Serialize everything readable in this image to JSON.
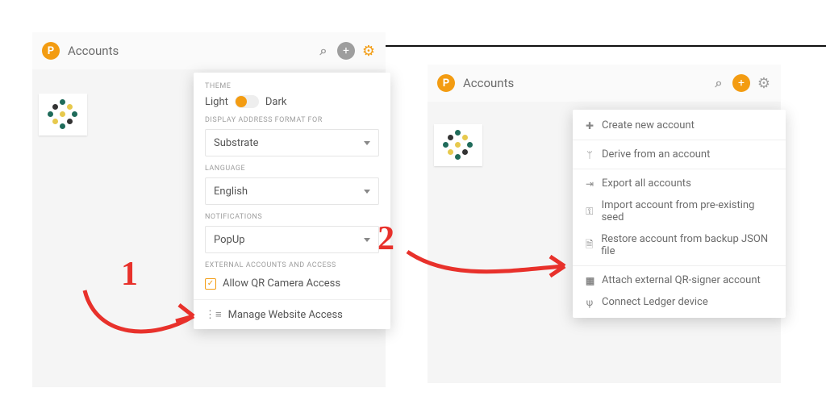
{
  "annotations": {
    "step1": "1",
    "step2": "2"
  },
  "panel1": {
    "title": "Accounts",
    "settings": {
      "theme_label": "THEME",
      "theme_light": "Light",
      "theme_dark": "Dark",
      "addr_label": "DISPLAY ADDRESS FORMAT FOR",
      "addr_value": "Substrate",
      "lang_label": "LANGUAGE",
      "lang_value": "English",
      "notif_label": "NOTIFICATIONS",
      "notif_value": "PopUp",
      "ext_label": "EXTERNAL ACCOUNTS AND ACCESS",
      "qr_checkbox": "Allow QR Camera Access",
      "manage": "Manage Website Access"
    }
  },
  "panel2": {
    "title": "Accounts",
    "menu": {
      "create": "Create new account",
      "derive": "Derive from an account",
      "export": "Export all accounts",
      "import": "Import account from pre-existing seed",
      "restore": "Restore account from backup JSON file",
      "qr": "Attach external QR-signer account",
      "ledger": "Connect Ledger device"
    }
  }
}
